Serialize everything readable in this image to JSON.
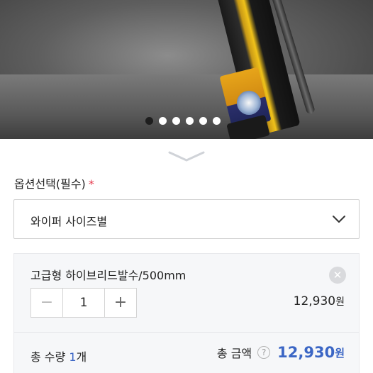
{
  "gallery": {
    "image_name": "wiper-product-image",
    "dots": [
      true,
      false,
      false,
      false,
      false,
      false
    ]
  },
  "options": {
    "label": "옵션선택(필수)",
    "required_mark": "*",
    "select_value": "와이퍼 사이즈별"
  },
  "selected_item": {
    "name": "고급형 하이브리드발수/500mm",
    "remove_icon": "close-icon",
    "quantity": "1",
    "minus_label": "−",
    "plus_label": "+",
    "price": "12,930",
    "currency": "원"
  },
  "summary": {
    "total_qty_label": "총 수량 ",
    "total_qty_value": "1",
    "total_qty_unit": "개",
    "total_amount_label": "총 금액",
    "help_icon": "?",
    "total_amount_value": "12,930",
    "currency": "원"
  },
  "colors": {
    "accent": "#3b66c5",
    "required": "#e5384b"
  }
}
